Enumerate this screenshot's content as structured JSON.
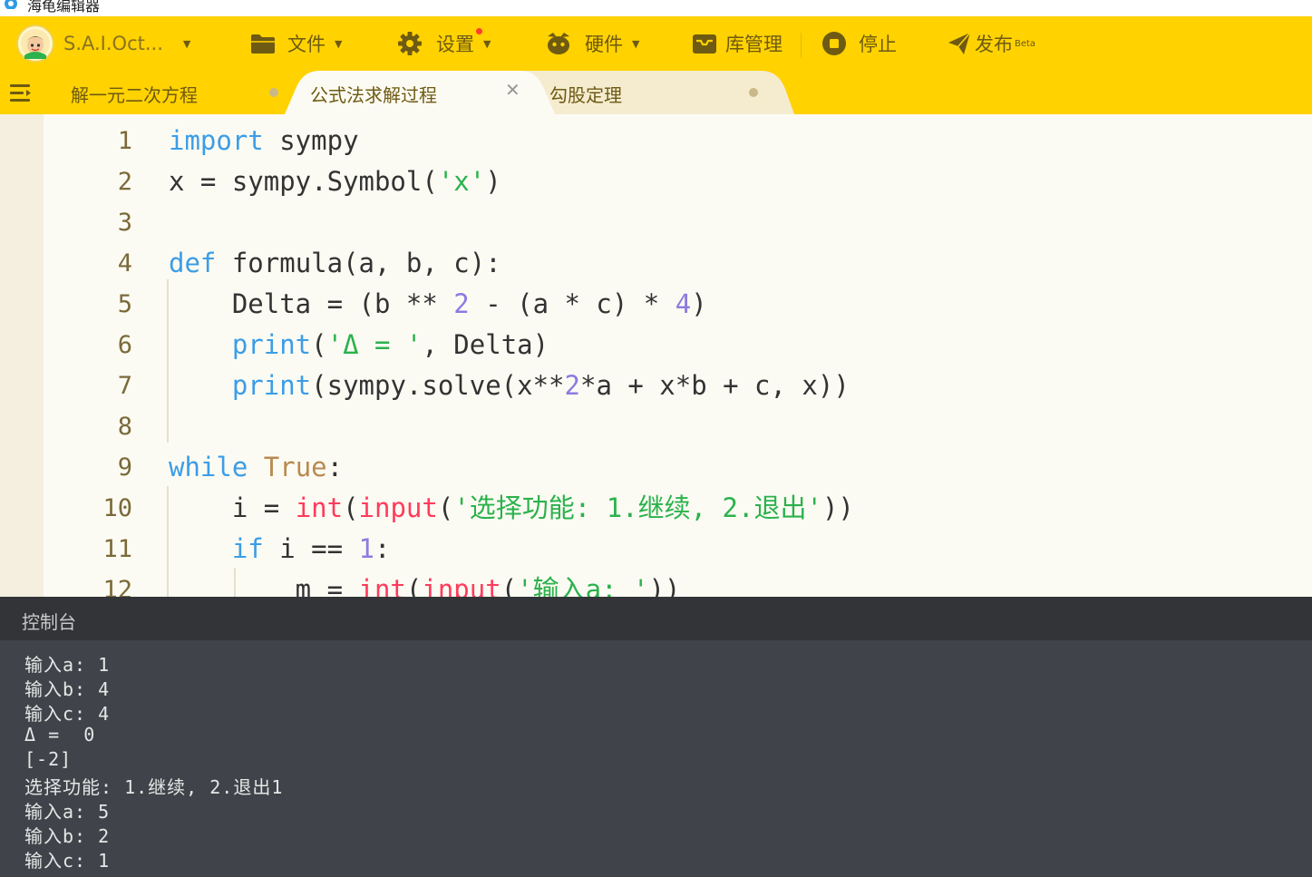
{
  "window": {
    "title": "海龟编辑器"
  },
  "toolbar": {
    "user": "S.A.I.Oct...",
    "file": "文件",
    "settings": "设置",
    "hardware": "硬件",
    "library": "库管理",
    "stop": "停止",
    "publish": "发布",
    "publish_badge": "Beta"
  },
  "tabs": [
    {
      "label": "解一元二次方程",
      "active": false
    },
    {
      "label": "公式法求解过程",
      "active": true
    },
    {
      "label": "勾股定理",
      "active": false
    }
  ],
  "tab_close_glyph": "✕",
  "editor": {
    "line_numbers": [
      "1",
      "2",
      "3",
      "4",
      "5",
      "6",
      "7",
      "8",
      "9",
      "10",
      "11",
      "12"
    ],
    "lines": [
      "import sympy",
      "x = sympy.Symbol('x')",
      "",
      "def formula(a, b, c):",
      "    Delta = (b ** 2 - (a * c) * 4)",
      "    print('Δ = ', Delta)",
      "    print(sympy.solve(x**2*a + x*b + c, x))",
      "",
      "while True:",
      "    i = int(input('选择功能: 1.继续, 2.退出'))",
      "    if i == 1:",
      "        m = int(input('输入a: '))"
    ]
  },
  "console": {
    "title": "控制台",
    "lines": [
      "输入a: 1",
      "输入b: 4",
      "输入c: 4",
      "Δ =  0",
      "[-2]",
      "选择功能: 1.继续, 2.退出1",
      "输入a: 5",
      "输入b: 2",
      "输入c: 1"
    ]
  },
  "colors": {
    "toolbar_bg": "#ffd200",
    "keyword": "#3c9de6",
    "string": "#2bb24c",
    "number": "#8e7be0",
    "builtin": "#ff3b5c",
    "console_bg": "#40444a"
  },
  "icons": [
    "app-icon",
    "avatar",
    "folder-icon",
    "gear-icon",
    "hardware-icon",
    "library-icon",
    "stop-icon",
    "send-icon",
    "menu-icon",
    "close-icon"
  ]
}
